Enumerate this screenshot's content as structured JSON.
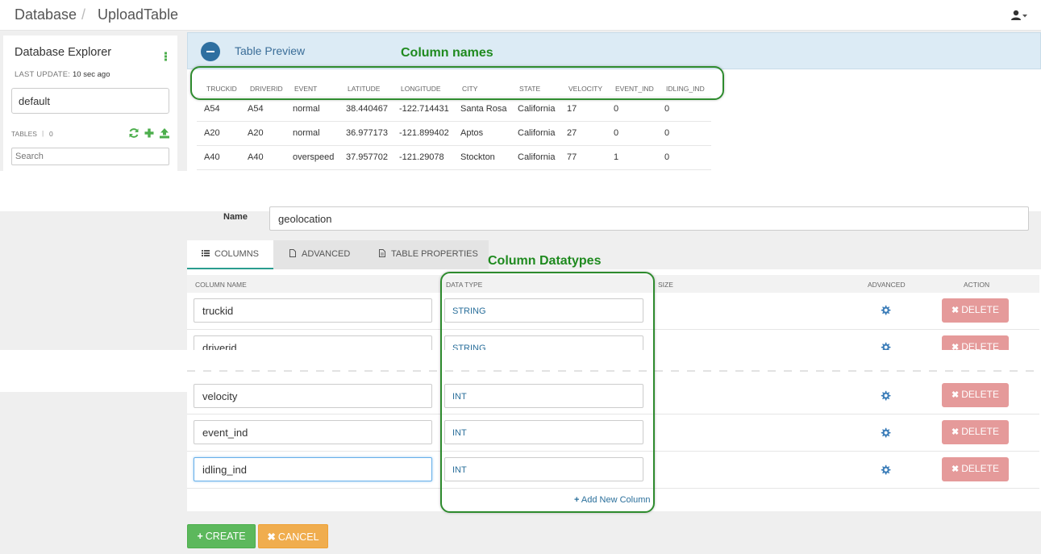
{
  "header": {
    "breadcrumb_root": "Database",
    "breadcrumb_sep": "/",
    "breadcrumb_page": "UploadTable",
    "user_icon": "user-icon"
  },
  "sidebar": {
    "title": "Database Explorer",
    "last_update_label": "LAST UPDATE:",
    "last_update_value": "10 sec ago",
    "database": "default",
    "tables_label": "TABLES",
    "tables_sep": "|",
    "tables_count": "0",
    "icons": [
      "refresh-icon",
      "add-icon",
      "upload-icon"
    ],
    "search_placeholder": "Search"
  },
  "preview": {
    "title": "Table Preview",
    "columns": [
      "TRUCKID",
      "DRIVERID",
      "EVENT",
      "LATITUDE",
      "LONGITUDE",
      "CITY",
      "STATE",
      "VELOCITY",
      "EVENT_IND",
      "IDLING_IND"
    ],
    "rows": [
      [
        "A54",
        "A54",
        "normal",
        "38.440467",
        "-122.714431",
        "Santa Rosa",
        "California",
        "17",
        "0",
        "0"
      ],
      [
        "A20",
        "A20",
        "normal",
        "36.977173",
        "-121.899402",
        "Aptos",
        "California",
        "27",
        "0",
        "0"
      ],
      [
        "A40",
        "A40",
        "overspeed",
        "37.957702",
        "-121.29078",
        "Stockton",
        "California",
        "77",
        "1",
        "0"
      ]
    ]
  },
  "annotations": {
    "column_names": "Column names",
    "column_datatypes": "Column Datatypes",
    "color": "#1f8a1f"
  },
  "form": {
    "name_label": "Name",
    "name_value": "geolocation"
  },
  "tabs": [
    {
      "label": "COLUMNS",
      "icon": "list-icon",
      "active": true
    },
    {
      "label": "ADVANCED",
      "icon": "file-icon",
      "active": false
    },
    {
      "label": "TABLE PROPERTIES",
      "icon": "file-text-icon",
      "active": false
    }
  ],
  "columns_table": {
    "headers": {
      "name": "COLUMN NAME",
      "type": "DATA TYPE",
      "size": "SIZE",
      "advanced": "ADVANCED",
      "action": "ACTION"
    },
    "rows": [
      {
        "name": "truckid",
        "type": "STRING"
      },
      {
        "name": "driverid",
        "type": "STRING"
      },
      {
        "name": "velocity",
        "type": "INT"
      },
      {
        "name": "event_ind",
        "type": "INT"
      },
      {
        "name": "idling_ind",
        "type": "INT"
      }
    ],
    "delete_label": "DELETE",
    "delete_symbol": "✖",
    "add_column_label": "Add New Column",
    "add_symbol": "+"
  },
  "actions": {
    "create_label": "CREATE",
    "create_symbol": "+",
    "cancel_label": "CANCEL",
    "cancel_symbol": "✖",
    "create_color": "#5cb85c",
    "cancel_color": "#f0ad4e",
    "delete_color": "#e59a9a"
  }
}
